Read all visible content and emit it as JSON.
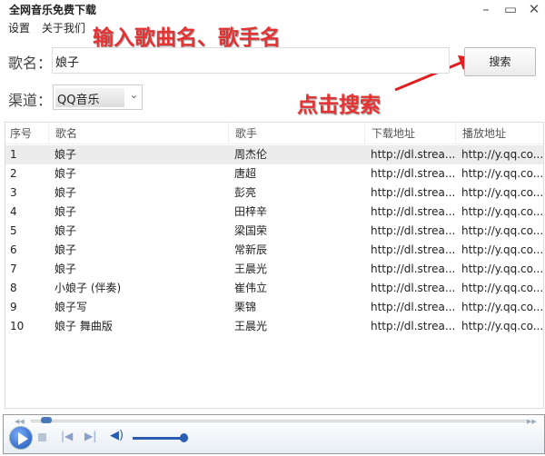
{
  "window": {
    "title": "全网音乐免费下载",
    "minimize": "–",
    "maximize": "▭",
    "close": "✕"
  },
  "menu": [
    "设置",
    "关于我们"
  ],
  "annotations": {
    "input_hint": "输入歌曲名、歌手名",
    "click_hint": "点击搜索"
  },
  "form": {
    "song_label": "歌名：",
    "song_value": "娘子",
    "search_label": "搜索",
    "channel_label": "渠道：",
    "channel_value": "QQ音乐"
  },
  "table": {
    "headers": [
      "序号",
      "歌名",
      "歌手",
      "下载地址",
      "播放地址"
    ],
    "rows": [
      [
        "1",
        "娘子",
        "周杰伦",
        "http://dl.strea...",
        "http://y.qq.co..."
      ],
      [
        "2",
        "娘子",
        "唐超",
        "http://dl.strea...",
        "http://y.qq.co..."
      ],
      [
        "3",
        "娘子",
        "彭亮",
        "http://dl.strea...",
        "http://y.qq.co..."
      ],
      [
        "4",
        "娘子",
        "田梓辛",
        "http://dl.strea...",
        "http://y.qq.co..."
      ],
      [
        "5",
        "娘子",
        "梁国荣",
        "http://dl.strea...",
        "http://y.qq.co..."
      ],
      [
        "6",
        "娘子",
        "常新辰",
        "http://dl.strea...",
        "http://y.qq.co..."
      ],
      [
        "7",
        "娘子",
        "王晨光",
        "http://dl.strea...",
        "http://y.qq.co..."
      ],
      [
        "8",
        "小娘子 (伴奏)",
        "崔伟立",
        "http://dl.strea...",
        "http://y.qq.co..."
      ],
      [
        "9",
        "娘子写",
        "栗锦",
        "http://dl.strea...",
        "http://y.qq.co..."
      ],
      [
        "10",
        "娘子 舞曲版",
        "王晨光",
        "http://dl.strea...",
        "http://y.qq.co..."
      ]
    ],
    "selected_row": 0
  },
  "player": {
    "progress": 0.02,
    "volume": 0.9
  }
}
